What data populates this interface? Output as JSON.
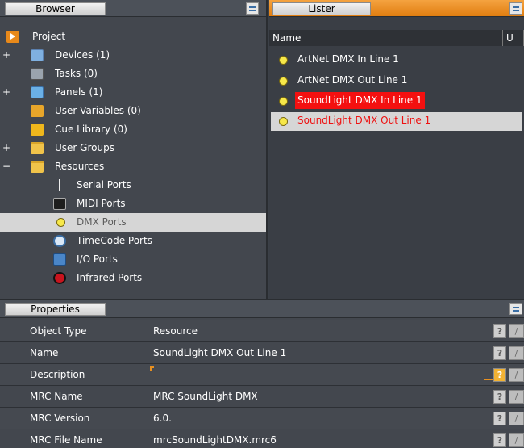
{
  "browser": {
    "tab_label": "Browser",
    "tree": [
      {
        "label": "Project",
        "expander": "",
        "icon": "project-icon"
      },
      {
        "label": "Devices (1)",
        "expander": "+",
        "icon": "devices-icon"
      },
      {
        "label": "Tasks (0)",
        "expander": "",
        "icon": "tasks-icon"
      },
      {
        "label": "Panels (1)",
        "expander": "+",
        "icon": "panels-icon"
      },
      {
        "label": "User Variables (0)",
        "expander": "",
        "icon": "user-variables-icon"
      },
      {
        "label": "Cue Library (0)",
        "expander": "",
        "icon": "cue-library-icon"
      },
      {
        "label": "User Groups",
        "expander": "+",
        "icon": "folder-icon"
      },
      {
        "label": "Resources",
        "expander": "−",
        "icon": "folder-icon"
      },
      {
        "label": "Serial Ports",
        "expander": "",
        "icon": "serial-port-icon"
      },
      {
        "label": "MIDI Ports",
        "expander": "",
        "icon": "midi-port-icon"
      },
      {
        "label": "DMX Ports",
        "expander": "",
        "icon": "dmx-port-icon"
      },
      {
        "label": "TimeCode Ports",
        "expander": "",
        "icon": "timecode-port-icon"
      },
      {
        "label": "I/O Ports",
        "expander": "",
        "icon": "io-port-icon"
      },
      {
        "label": "Infrared Ports",
        "expander": "",
        "icon": "infrared-port-icon"
      }
    ]
  },
  "lister": {
    "tab_label": "Lister",
    "columns": [
      "Name",
      "U"
    ],
    "items": [
      {
        "label": "ArtNet DMX In Line 1",
        "icon": "dmx-port-icon"
      },
      {
        "label": "ArtNet DMX Out Line 1",
        "icon": "dmx-port-icon"
      },
      {
        "label": "SoundLight DMX In Line 1",
        "icon": "dmx-port-icon"
      },
      {
        "label": "SoundLight DMX Out Line 1",
        "icon": "dmx-port-icon"
      }
    ]
  },
  "properties": {
    "tab_label": "Properties",
    "rows": [
      {
        "name": "Object Type",
        "value": "Resource"
      },
      {
        "name": "Name",
        "value": "SoundLight DMX Out Line 1"
      },
      {
        "name": "Description",
        "value": ""
      },
      {
        "name": "MRC Name",
        "value": "MRC SoundLight DMX"
      },
      {
        "name": "MRC Version",
        "value": "6.0."
      },
      {
        "name": "MRC File Name",
        "value": "mrcSoundLightDMX.mrc6"
      }
    ],
    "help_glyph": "?",
    "edit_glyph": "/"
  },
  "colors": {
    "lister_header": "#e8891a",
    "highlight_red": "#f41010",
    "selected_row": "#d6d6d6"
  }
}
